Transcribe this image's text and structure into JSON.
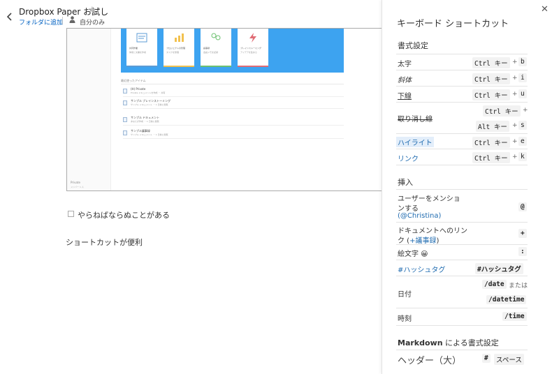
{
  "header": {
    "doc_title": "Dropbox Paper お試し",
    "add_folder": "フォルダに追加",
    "owner": "自分のみ"
  },
  "embed": {
    "cards": [
      {
        "title": "共同作業",
        "sub": "仲間と文書を作成",
        "color": "#5b9bd5"
      },
      {
        "title": "プロジェクトの管理",
        "sub": "タスクを整理",
        "color": "#f2c14e"
      },
      {
        "title": "議事録",
        "sub": "会議メモを記録",
        "color": "#6cc070"
      },
      {
        "title": "ブレインストーミング",
        "sub": "アイデアを集める",
        "color": "#e06c75"
      }
    ],
    "recent_heading": "最近使ったアイテム",
    "recent": [
      {
        "title": "(H) Private",
        "sub": "Private ドキュメントを作成 ・ 共有"
      },
      {
        "title": "サンプル ブレインストーミング",
        "sub": "サンプル ドキュメント ・ 1 日前に閲覧"
      },
      {
        "title": "サンプル ドキュメント",
        "sub": "あなたが作成 ・ 1 日前に閲覧"
      },
      {
        "title": "サンプル議事録",
        "sub": "サンプル ドキュメント ・ 1 日前に閲覧"
      }
    ],
    "sidebar_label": "Private",
    "sidebar_sub": "メンバー 1 人"
  },
  "content": {
    "todo": "やらねばならぬことがある",
    "paragraph": "ショートカットが便利"
  },
  "panel": {
    "title": "キーボード ショートカット",
    "sections": {
      "format": "書式設定",
      "insert": "挿入",
      "markdown_bold": "Markdown",
      "markdown_rest": " による書式設定"
    },
    "ctrl_key": "Ctrl キー",
    "plus": "+",
    "alt_key": "Alt キー",
    "format": {
      "bold": {
        "label": "太字",
        "key": "b"
      },
      "italic": {
        "label": "斜体",
        "key": "i"
      },
      "underline": {
        "label": "下線",
        "key": "u"
      },
      "strike": {
        "label": "取り消し線",
        "key": "s"
      },
      "highlight": {
        "label": "ハイライト",
        "key": "e"
      },
      "link": {
        "label": "リンク",
        "key": "k"
      }
    },
    "insert": {
      "mention_l1": "ユーザーをメンショ",
      "mention_l2": "ンする",
      "mention_l3": "(@Christina)",
      "mention_key": "@",
      "docref_l1": "ドキュメントへのリン",
      "docref_l2a": "ク (",
      "docref_l2b": "+議事録",
      "docref_l2c": ")",
      "docref_key": "+",
      "emoji_label": "絵文字 😀",
      "emoji_key": ":",
      "hashtag_label": "#ハッシュタグ",
      "hashtag_key": "#ハッシュタグ",
      "date_label": "日付",
      "date_key": "/date",
      "or": "または",
      "datetime_key": "/datetime",
      "time_label": "時刻",
      "time_key": "/time"
    },
    "markdown": {
      "header1": "ヘッダー（大）",
      "header1_key1": "#",
      "header1_key2": "スペース"
    }
  }
}
